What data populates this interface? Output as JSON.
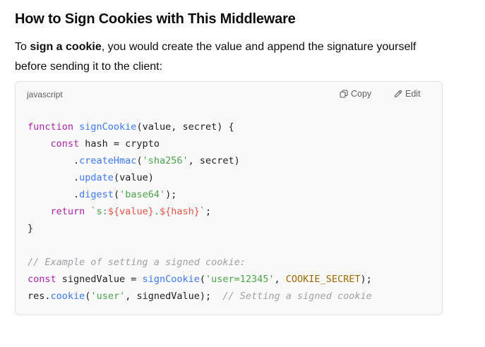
{
  "heading": "How to Sign Cookies with This Middleware",
  "paragraph": {
    "prefix": "To ",
    "bold": "sign a cookie",
    "suffix": ", you would create the value and append the signature yourself before sending it to the client:"
  },
  "code_block": {
    "language": "javascript",
    "copy_label": "Copy",
    "edit_label": "Edit",
    "icons": {
      "copy": "copy-icon",
      "edit": "pencil-icon"
    },
    "lines": [
      [
        {
          "t": "kw",
          "v": "function "
        },
        {
          "t": "fn",
          "v": "signCookie"
        },
        {
          "t": "pl",
          "v": "(value, secret) {"
        }
      ],
      [
        {
          "t": "pl",
          "v": "    "
        },
        {
          "t": "kw",
          "v": "const"
        },
        {
          "t": "pl",
          "v": " hash = crypto"
        }
      ],
      [
        {
          "t": "pl",
          "v": "        ."
        },
        {
          "t": "fn",
          "v": "createHmac"
        },
        {
          "t": "pl",
          "v": "("
        },
        {
          "t": "str",
          "v": "'sha256'"
        },
        {
          "t": "pl",
          "v": ", secret)"
        }
      ],
      [
        {
          "t": "pl",
          "v": "        ."
        },
        {
          "t": "fn",
          "v": "update"
        },
        {
          "t": "pl",
          "v": "(value)"
        }
      ],
      [
        {
          "t": "pl",
          "v": "        ."
        },
        {
          "t": "fn",
          "v": "digest"
        },
        {
          "t": "pl",
          "v": "("
        },
        {
          "t": "str",
          "v": "'base64'"
        },
        {
          "t": "pl",
          "v": ");"
        }
      ],
      [
        {
          "t": "pl",
          "v": "    "
        },
        {
          "t": "kw",
          "v": "return"
        },
        {
          "t": "pl",
          "v": " "
        },
        {
          "t": "str",
          "v": "`s:"
        },
        {
          "t": "tpl",
          "v": "${value}"
        },
        {
          "t": "str",
          "v": "."
        },
        {
          "t": "tpl",
          "v": "${hash}"
        },
        {
          "t": "str",
          "v": "`"
        },
        {
          "t": "pl",
          "v": ";"
        }
      ],
      [
        {
          "t": "pl",
          "v": "}"
        }
      ],
      [
        {
          "t": "pl",
          "v": ""
        }
      ],
      [
        {
          "t": "cm",
          "v": "// Example of setting a signed cookie:"
        }
      ],
      [
        {
          "t": "kw",
          "v": "const"
        },
        {
          "t": "pl",
          "v": " signedValue = "
        },
        {
          "t": "fn",
          "v": "signCookie"
        },
        {
          "t": "pl",
          "v": "("
        },
        {
          "t": "str",
          "v": "'user=12345'"
        },
        {
          "t": "pl",
          "v": ", "
        },
        {
          "t": "cst",
          "v": "COOKIE_SECRET"
        },
        {
          "t": "pl",
          "v": ");"
        }
      ],
      [
        {
          "t": "pl",
          "v": "res."
        },
        {
          "t": "fn",
          "v": "cookie"
        },
        {
          "t": "pl",
          "v": "("
        },
        {
          "t": "str",
          "v": "'user'"
        },
        {
          "t": "pl",
          "v": ", signedValue);  "
        },
        {
          "t": "cm",
          "v": "// Setting a signed cookie"
        }
      ]
    ]
  }
}
